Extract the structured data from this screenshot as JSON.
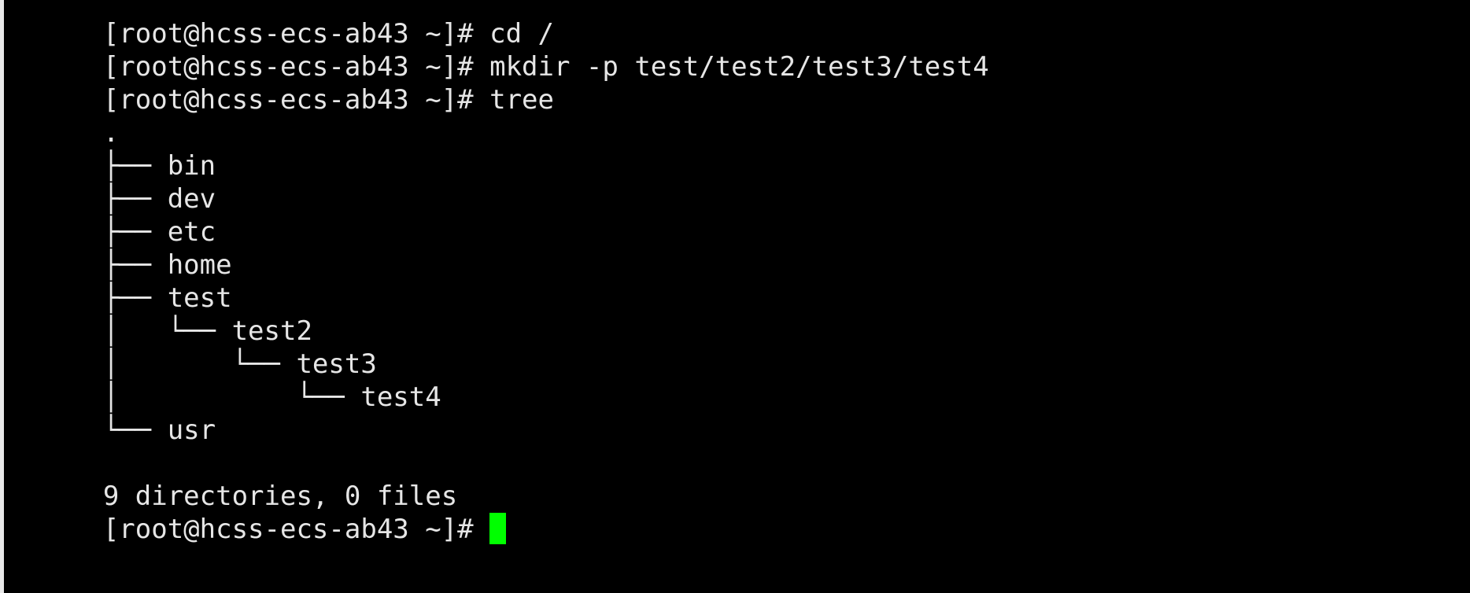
{
  "terminal": {
    "background_color": "#000000",
    "foreground_color": "#e6e6e6",
    "cursor_color": "#00ff00",
    "scrollbar_color": "#e8e8e8",
    "prompt": "[root@hcss-ecs-ab43 ~]# ",
    "cursor_glyph": " "
  },
  "lines": [
    {
      "kind": "prompt-clipped",
      "prompt": "[root@hcss-ecs-ab43 ~]# ",
      "command": "cd /"
    },
    {
      "kind": "prompt",
      "prompt": "[root@hcss-ecs-ab43 ~]# ",
      "command": "mkdir -p test/test2/test3/test4"
    },
    {
      "kind": "prompt",
      "prompt": "[root@hcss-ecs-ab43 ~]# ",
      "command": "tree"
    },
    {
      "kind": "output",
      "text": "."
    },
    {
      "kind": "output",
      "text": "├── bin"
    },
    {
      "kind": "output",
      "text": "├── dev"
    },
    {
      "kind": "output",
      "text": "├── etc"
    },
    {
      "kind": "output",
      "text": "├── home"
    },
    {
      "kind": "output",
      "text": "├── test"
    },
    {
      "kind": "output",
      "text": "│   └── test2"
    },
    {
      "kind": "output",
      "text": "│       └── test3"
    },
    {
      "kind": "output",
      "text": "│           └── test4"
    },
    {
      "kind": "output",
      "text": "└── usr"
    },
    {
      "kind": "output",
      "text": ""
    },
    {
      "kind": "output",
      "text": "9 directories, 0 files"
    },
    {
      "kind": "prompt-cursor",
      "prompt": "[root@hcss-ecs-ab43 ~]# ",
      "command": ""
    }
  ],
  "summary": {
    "directories_count": "9",
    "files_count": "0",
    "text": "9 directories, 0 files"
  },
  "tree_root": {
    "label": ".",
    "children": [
      {
        "label": "bin"
      },
      {
        "label": "dev"
      },
      {
        "label": "etc"
      },
      {
        "label": "home"
      },
      {
        "label": "test",
        "children": [
          {
            "label": "test2",
            "children": [
              {
                "label": "test3",
                "children": [
                  {
                    "label": "test4"
                  }
                ]
              }
            ]
          }
        ]
      },
      {
        "label": "usr"
      }
    ]
  },
  "commands": {
    "mkdir": "mkdir -p test/test2/test3/test4",
    "tree": "tree"
  }
}
